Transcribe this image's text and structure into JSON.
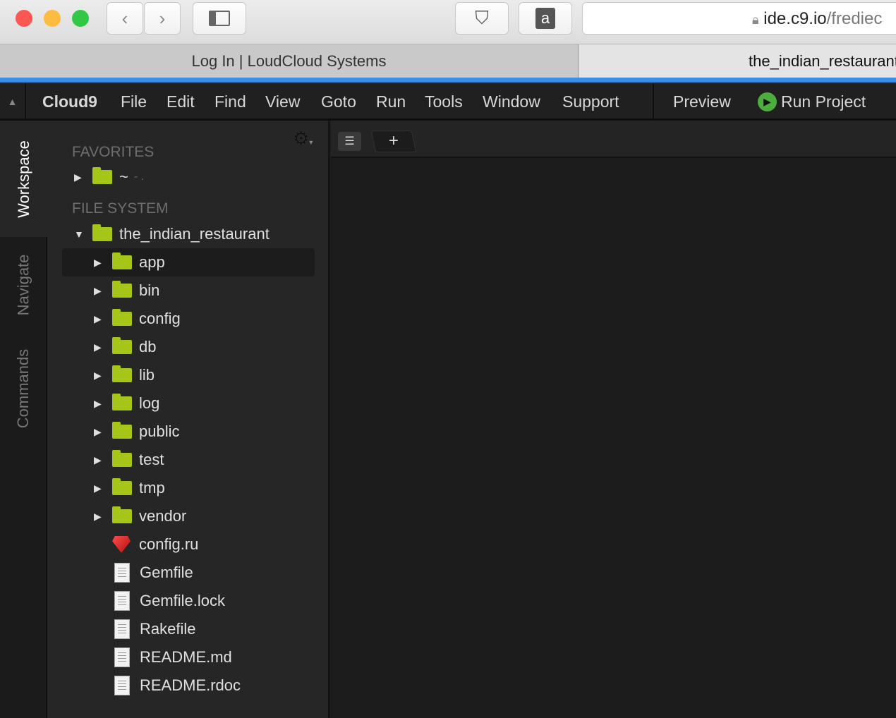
{
  "browser": {
    "url_host": "ide.c9.io",
    "url_path": "/frediec",
    "tabs": [
      "Log In | LoudCloud Systems",
      "the_indian_restaurant"
    ]
  },
  "menu": {
    "items": [
      "Cloud9",
      "File",
      "Edit",
      "Find",
      "View",
      "Goto",
      "Run",
      "Tools",
      "Window",
      "Support"
    ],
    "preview": "Preview",
    "run_project": "Run Project"
  },
  "side_tabs": [
    "Workspace",
    "Navigate",
    "Commands"
  ],
  "tree": {
    "favorites_label": "FAVORITES",
    "favorite": "~",
    "favorite_suffix": "- .",
    "fs_label": "FILE SYSTEM",
    "root": "the_indian_restaurant",
    "folders": [
      "app",
      "bin",
      "config",
      "db",
      "lib",
      "log",
      "public",
      "test",
      "tmp",
      "vendor"
    ],
    "files": [
      "config.ru",
      "Gemfile",
      "Gemfile.lock",
      "Rakefile",
      "README.md",
      "README.rdoc"
    ]
  },
  "colors": {
    "accent": "#3b8eea",
    "folder": "#a5c518",
    "run": "#4cae3c"
  }
}
